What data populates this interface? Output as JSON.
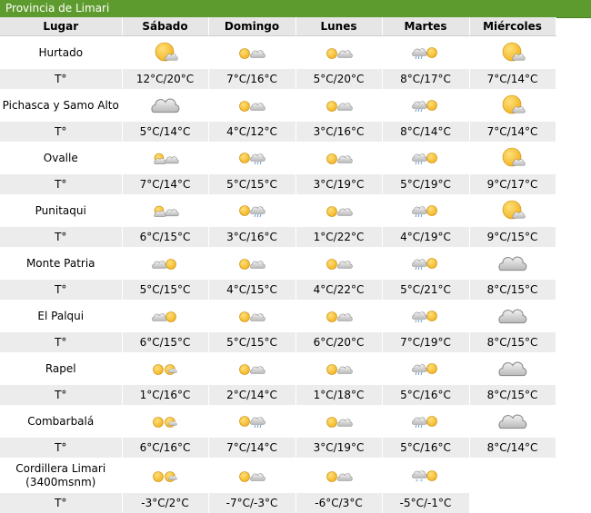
{
  "banner": {
    "title": "Provincia de Limari"
  },
  "headers": [
    "Lugar",
    "Sábado",
    "Domingo",
    "Lunes",
    "Martes",
    "Miércoles"
  ],
  "temp_label": "T°",
  "places": [
    {
      "name": "Hurtado",
      "icons": [
        "sun-big",
        "sun-cloud",
        "sun-cloud",
        "cloud-rain-sun",
        "sun-big"
      ],
      "temps": [
        "12°C/20°C",
        "7°C/16°C",
        "5°C/20°C",
        "8°C/17°C",
        "7°C/14°C"
      ]
    },
    {
      "name": "Pichasca y Samo Alto",
      "icons": [
        "cloud-big",
        "sun-cloud",
        "sun-cloud",
        "cloud-rain-sun",
        "sun-big"
      ],
      "temps": [
        "5°C/14°C",
        "4°C/12°C",
        "3°C/16°C",
        "8°C/14°C",
        "7°C/14°C"
      ]
    },
    {
      "name": "Ovalle",
      "icons": [
        "sun-cloud-small",
        "sun-rain",
        "sun-cloud",
        "cloud-rain-sun",
        "sun-big"
      ],
      "temps": [
        "7°C/14°C",
        "5°C/15°C",
        "3°C/19°C",
        "5°C/19°C",
        "9°C/17°C"
      ]
    },
    {
      "name": "Punitaqui",
      "icons": [
        "sun-cloud-small",
        "sun-rain",
        "sun-cloud",
        "cloud-rain-sun",
        "sun-big"
      ],
      "temps": [
        "6°C/15°C",
        "3°C/16°C",
        "1°C/22°C",
        "4°C/19°C",
        "9°C/15°C"
      ]
    },
    {
      "name": "Monte Patria",
      "icons": [
        "cloud-sun",
        "sun-cloud",
        "sun-cloud",
        "cloud-rain-sun",
        "cloud-big"
      ],
      "temps": [
        "5°C/15°C",
        "4°C/15°C",
        "4°C/22°C",
        "5°C/21°C",
        "8°C/15°C"
      ]
    },
    {
      "name": "El Palqui",
      "icons": [
        "cloud-sun",
        "sun-cloud",
        "sun-cloud",
        "cloud-rain-sun",
        "cloud-big"
      ],
      "temps": [
        "6°C/15°C",
        "5°C/15°C",
        "6°C/20°C",
        "7°C/19°C",
        "8°C/15°C"
      ]
    },
    {
      "name": "Rapel",
      "icons": [
        "sun-sun",
        "sun-cloud",
        "sun-cloud",
        "cloud-rain-sun",
        "cloud-big"
      ],
      "temps": [
        "1°C/16°C",
        "2°C/14°C",
        "1°C/18°C",
        "5°C/16°C",
        "8°C/15°C"
      ]
    },
    {
      "name": "Combarbalá",
      "icons": [
        "sun-sun",
        "sun-rain",
        "sun-cloud",
        "cloud-rain-sun",
        "cloud-big"
      ],
      "temps": [
        "6°C/16°C",
        "7°C/14°C",
        "3°C/19°C",
        "5°C/16°C",
        "8°C/14°C"
      ]
    },
    {
      "name": "Cordillera Limari (3400msnm)",
      "icons": [
        "sun-sun",
        "sun-cloud",
        "sun-cloud",
        "snow-sun",
        ""
      ],
      "temps": [
        "-3°C/2°C",
        "-7°C/-3°C",
        "-6°C/3°C",
        "-5°C/-1°C",
        ""
      ]
    }
  ]
}
